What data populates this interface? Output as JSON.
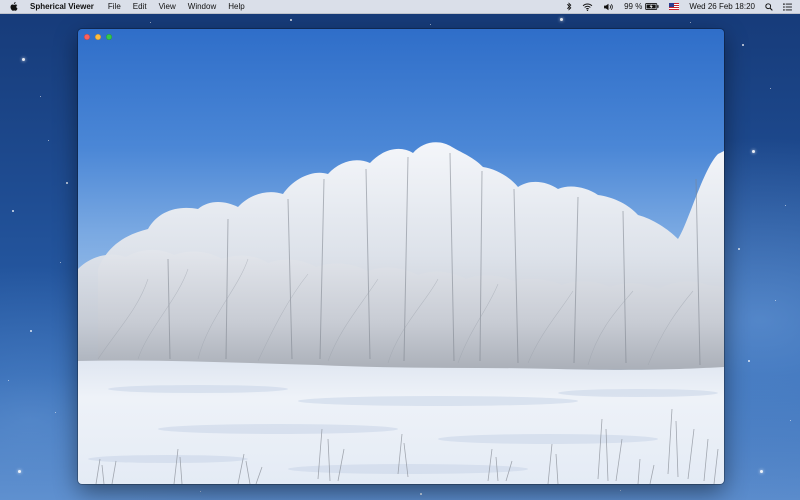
{
  "menubar": {
    "apple_icon": "apple-logo-icon",
    "app_name": "Spherical Viewer",
    "menus": [
      "File",
      "Edit",
      "View",
      "Window",
      "Help"
    ],
    "status": {
      "bluetooth_icon": "bluetooth-icon",
      "wifi_icon": "wifi-icon",
      "volume_icon": "volume-icon",
      "battery_percent": "99 %",
      "battery_icon": "battery-charging-icon",
      "input_source_icon": "us-flag-icon",
      "clock": "Wed 26 Feb  18:20",
      "spotlight_icon": "search-icon",
      "notification_icon": "list-icon"
    }
  },
  "window": {
    "title": "",
    "controls": [
      "close",
      "minimize",
      "zoom"
    ],
    "content": "panorama-image-snowy-frosted-trees"
  },
  "colors": {
    "sky_top": "#2f6ec9",
    "sky_bottom": "#a8c8ee",
    "frost": "#e9edf3",
    "snow": "#eef2f8",
    "desktop": "#1f4d93"
  }
}
